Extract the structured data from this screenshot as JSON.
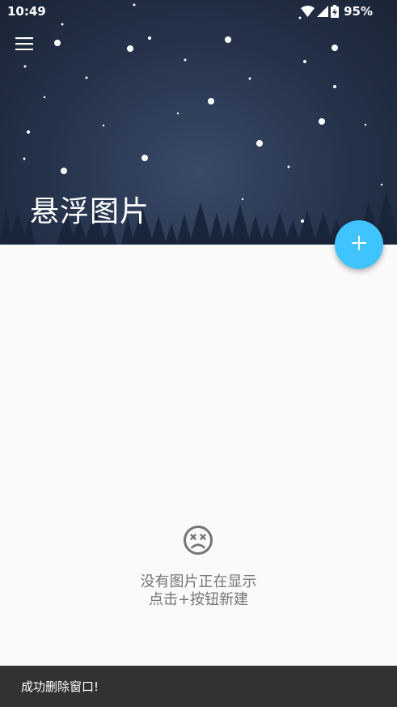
{
  "status_bar": {
    "time": "10:49",
    "battery_percent": "95%",
    "icons": [
      "wifi-icon",
      "cell-signal-icon",
      "battery-charging-icon"
    ]
  },
  "header": {
    "title": "悬浮图片",
    "menu_icon": "hamburger-menu-icon",
    "background": "night-sky-with-snow-and-pine-trees"
  },
  "fab": {
    "icon": "plus-icon",
    "color": "#40c4ff"
  },
  "empty_state": {
    "icon": "sad-face-icon",
    "line1": "没有图片正在显示",
    "line2": "点击+按钮新建"
  },
  "snackbar": {
    "message": "成功删除窗口!"
  },
  "colors": {
    "header_bg": "#25324a",
    "page_bg": "#fafafa",
    "fab": "#40c4ff",
    "snackbar_bg": "#323232",
    "empty_text": "#757575"
  }
}
